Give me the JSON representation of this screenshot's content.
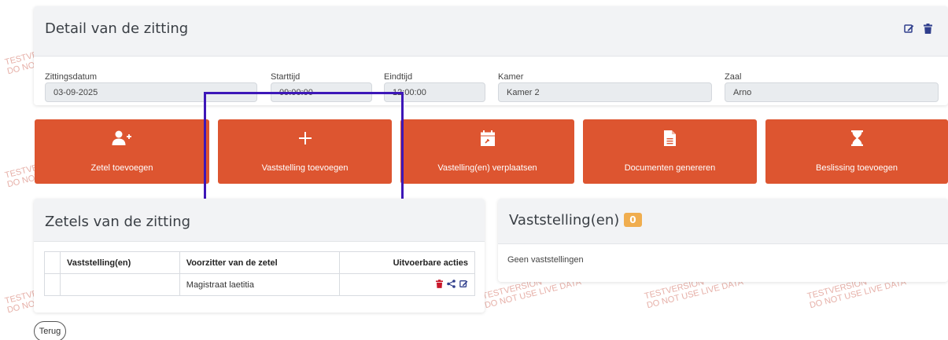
{
  "detail": {
    "title": "Detail van de zitting",
    "fields": {
      "datum_label": "Zittingsdatum",
      "datum_value": "03-09-2025",
      "start_label": "Starttijd",
      "start_value": "09:00:00",
      "eind_label": "Eindtijd",
      "eind_value": "12:00:00",
      "kamer_label": "Kamer",
      "kamer_value": "Kamer 2",
      "zaal_label": "Zaal",
      "zaal_value": "Arno"
    }
  },
  "actions": {
    "zetel": "Zetel toevoegen",
    "vaststelling": "Vaststelling toevoegen",
    "verplaatsen": "Vastelling(en) verplaatsen",
    "documenten": "Documenten genereren",
    "beslissing": "Beslissing toevoegen"
  },
  "zetels": {
    "title": "Zetels van de zitting",
    "columns": [
      "Vaststelling(en)",
      "Voorzitter van de zetel",
      "Uitvoerbare acties"
    ],
    "rows": [
      {
        "vaststelling": "",
        "voorzitter": "Magistraat laetitia"
      }
    ]
  },
  "vaststellingen": {
    "title": "Vaststelling(en)",
    "count": "0",
    "empty": "Geen vaststellingen"
  },
  "back_label": "Terug",
  "watermark": {
    "line1": "TESTVERSION",
    "line2": "DO NOT USE LIVE DATA"
  },
  "colors": {
    "accent": "#dd5530",
    "highlight": "#3d17b8",
    "badge": "#f0ad4e",
    "icon": "#2f3e8c",
    "delete": "#c9182b"
  },
  "icons": [
    "edit-icon",
    "trash-icon",
    "user-plus-icon",
    "plus-icon",
    "calendar-move-icon",
    "document-icon",
    "hourglass-icon",
    "share-icon"
  ]
}
